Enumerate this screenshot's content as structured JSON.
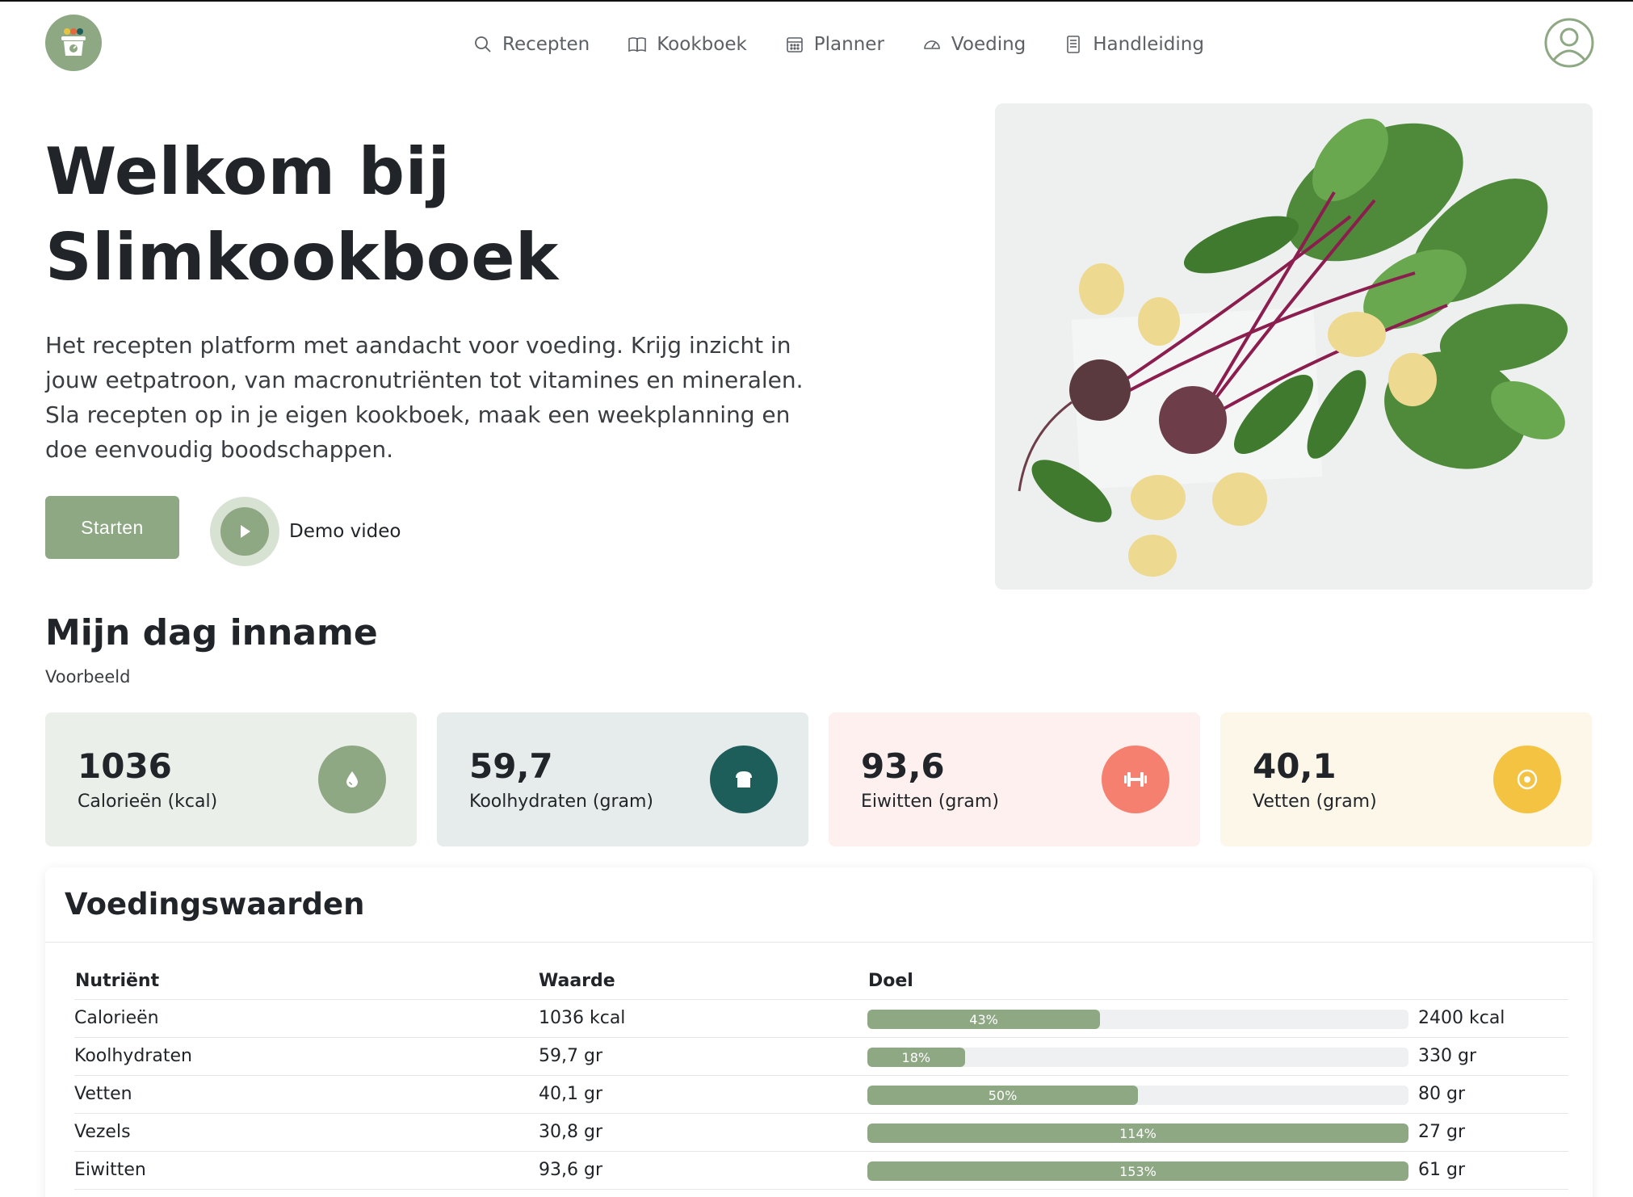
{
  "nav": {
    "items": [
      {
        "label": "Recepten",
        "icon": "search-icon"
      },
      {
        "label": "Kookboek",
        "icon": "book-icon"
      },
      {
        "label": "Planner",
        "icon": "calendar-icon"
      },
      {
        "label": "Voeding",
        "icon": "speedometer-icon"
      },
      {
        "label": "Handleiding",
        "icon": "document-icon"
      }
    ]
  },
  "hero": {
    "title_line1": "Welkom bij",
    "title_line2": "Slimkookboek",
    "lead": "Het recepten platform met aandacht voor voeding. Krijg inzicht in jouw eetpatroon, van macronutriënten tot vitamines en mineralen. Sla recepten op in je eigen kookboek, maak een weekplanning en doe eenvoudig boodschappen.",
    "start_label": "Starten",
    "demo_label": "Demo video"
  },
  "intake": {
    "title": "Mijn dag inname",
    "subtitle": "Voorbeeld",
    "cards": [
      {
        "value": "1036",
        "label": "Calorieën (kcal)",
        "icon": "drop-icon",
        "bg": "#ebefe9",
        "icon_bg": "#8ea884"
      },
      {
        "value": "59,7",
        "label": "Koolhydraten (gram)",
        "icon": "bread-icon",
        "bg": "#e6ecec",
        "icon_bg": "#1e5e5a"
      },
      {
        "value": "93,6",
        "label": "Eiwitten (gram)",
        "icon": "dumbbell-icon",
        "bg": "#fdf0ee",
        "icon_bg": "#f58070"
      },
      {
        "value": "40,1",
        "label": "Vetten (gram)",
        "icon": "target-icon",
        "bg": "#fdf7ea",
        "icon_bg": "#f5c342"
      }
    ]
  },
  "nutrition": {
    "title": "Voedingswaarden",
    "headers": {
      "nutrient": "Nutriënt",
      "value": "Waarde",
      "goal": "Doel"
    },
    "rows": [
      {
        "nutrient": "Calorieën",
        "value": "1036 kcal",
        "percent_label": "43%",
        "percent": 43,
        "goal": "2400 kcal"
      },
      {
        "nutrient": "Koolhydraten",
        "value": "59,7 gr",
        "percent_label": "18%",
        "percent": 18,
        "goal": "330 gr"
      },
      {
        "nutrient": "Vetten",
        "value": "40,1 gr",
        "percent_label": "50%",
        "percent": 50,
        "goal": "80 gr"
      },
      {
        "nutrient": "Vezels",
        "value": "30,8 gr",
        "percent_label": "114%",
        "percent": 114,
        "goal": "27 gr"
      },
      {
        "nutrient": "Eiwitten",
        "value": "93,6 gr",
        "percent_label": "153%",
        "percent": 153,
        "goal": "61 gr"
      }
    ]
  },
  "colors": {
    "accent": "#8ea884"
  }
}
